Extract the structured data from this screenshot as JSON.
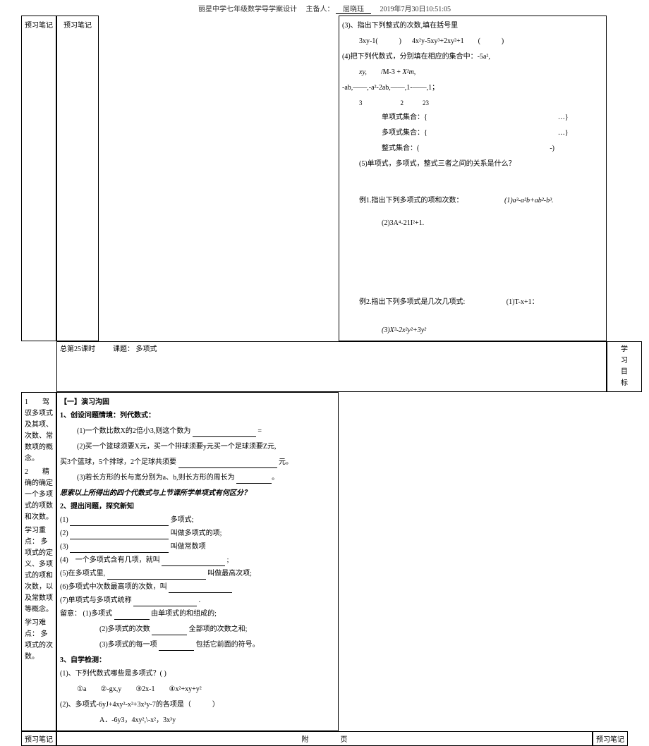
{
  "header": {
    "school": "丽星中学七年级数学导学案设计",
    "preparer_label": "主备人：",
    "preparer_name": "屈晓珏",
    "datetime": "2019年7月30日10:51:05"
  },
  "margins": {
    "note_label": "预习笔记"
  },
  "title_row": {
    "period": "总第25课时",
    "lesson_label": "课题：",
    "lesson": "多项式"
  },
  "goals": {
    "label": "学习目标",
    "item1": "1　　驾驭多项式及其项、次数、常数项的概念。",
    "item2": "2　　精确的确定一个多项式的项数和次数。",
    "point_label": "学习重点：",
    "point": "多项式的定义、多项式的项和次数，以及常数项等概念。",
    "diff_label": "学习难点：",
    "diff": "多项式的次数。"
  },
  "left_body": {
    "sec1_head": "【一】演习沟固",
    "q1_head": "1、创设问题情境：列代数式：",
    "q1_1": "(1)一个数比数X的2倍小3,则这个数为",
    "q1_2": "(2)买一个篮球须要X元，买一个排球须要y元买一个足球须要Z元,",
    "q1_2b": "买3个篮球，5个排球，2个足球共须要",
    "q1_2c": "元。",
    "q1_3": "(3)若长方形的长与宽分别为a、b,则长方形的周长为",
    "think": "思索以上所得出的四个代数式与上节课所学单项式有何区分？",
    "q2_head": "2、提出问题，探究新知",
    "q2_1": "(1)",
    "q2_1_suffix": "多项式;",
    "q2_2": "(2)",
    "q2_2_suffix": "叫做多项式的项;",
    "q2_3": "(3)",
    "q2_3_suffix": "叫做常数项",
    "q2_4": "(4)　一个多项式含有几项，就叫",
    "q2_5": "(5)在多项式里,",
    "q2_5_suffix": "叫做最高次项;",
    "q2_6": "(6)多项式中次数最高项的次数，叫",
    "q2_7": "(7)单项式与多项式统称",
    "note_head": "留意：",
    "note1": "(1)多项式",
    "note1_suffix": "由单项式的和组成的;",
    "note2": "(2)多项式的次数",
    "note2_suffix": "全部项的次数之和;",
    "note3": "(3)多项式的每一项",
    "note3_suffix": "包括它前面的符号。",
    "q3_head": "3、自学检测：",
    "q3_1": "(1)、下列代数式哪些是多项式？( )",
    "q3_1_opts": "①a　　②-gx,y　　③2x-1　　④x²+xy+y²",
    "q3_2": "(2)、多项式-6yJ+4xy²-x²+3x³y-7的各项是（　　　）",
    "q3_2_optA": "A．-6y3，4xy²,\\-x²，3x³y"
  },
  "right_body": {
    "r3": "(3)、指出下列整式的次数,填在括号里",
    "r3_e1a": "3xy-1(　　　)",
    "r3_e1b": "4x²y-5xy³+2xy²+1　　(　　　)",
    "r4": "(4)把下列代数式，分别填在相应的集合中：-5a²,",
    "r4_line2a": "xy,",
    "r4_line2b": "/M-3 +",
    "r4_line2c": "X²m,",
    "r4_line3": "-ab,——,-a²-2ab,——,1-——,1；",
    "r4_line3_nums": "3　　　　　　2　　　23",
    "set1_label": "单项式集合：{",
    "set_close": "…}",
    "set2_label": "多项式集合：{",
    "set3_label": "整式集合：(",
    "set3_close": "-)",
    "r5": "(5)单项式，多项式，整式三者之间的关系是什么？",
    "ex1": "例1.指出下列多项式的项和次数：",
    "ex1_1": "(1)a³-a²b+ab²-b³.",
    "ex1_2": "(2)3A⁴-21I²+1.",
    "ex2": "例2.指出下列多项式是几次几项式:",
    "ex2_1": "(1)T-x+1：",
    "ex2_2": "(3)X³-2x²y²+3y²"
  },
  "footer": {
    "left": "预习笔记",
    "center_a": "附",
    "center_b": "页",
    "right": "预习笔记"
  }
}
